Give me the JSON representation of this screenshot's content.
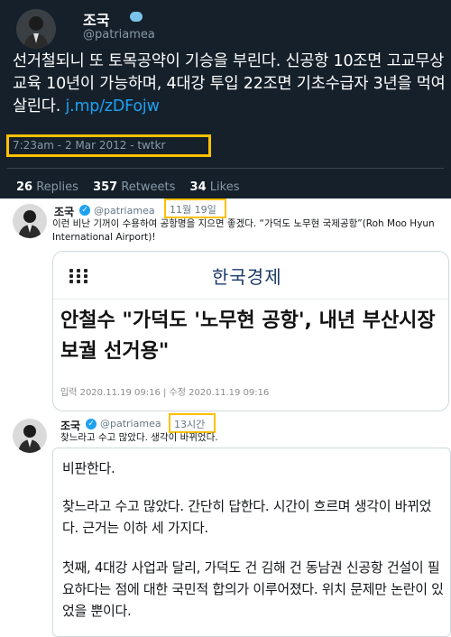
{
  "tweet_dark": {
    "name": "조국",
    "handle": "@patriamea",
    "text": "선거철되니 또 토목공약이 기승을 부린다. 신공항 10조면 고교무상교육 10년이 가능하며, 4대강 투입 22조면 기초수급자 3년을 먹여살린다. ",
    "link": "j.mp/zDFojw",
    "timestamp": "7:23am - 2 Mar 2012 - twtkr",
    "stats": {
      "replies_count": "26",
      "replies_label": "Replies",
      "retweets_count": "357",
      "retweets_label": "Retweets",
      "likes_count": "34",
      "likes_label": "Likes"
    }
  },
  "tweet_card": {
    "name": "조국",
    "handle": "@patriamea",
    "date": "11월 19일",
    "text": "이런 비난 기꺼이 수용하여 공항명을 지으면 좋겠다. “가덕도 노무현 국제공항”(Roh Moo Hyun International Airport)!",
    "card": {
      "source": "한국경제",
      "headline": "안철수 \"가덕도 '노무현 공항', 내년 부산시장 보궐 선거용\"",
      "meta": "입력 2020.11.19 09:16  |  수정 2020.11.19 09:16"
    }
  },
  "tweet_essay": {
    "name": "조국",
    "handle": "@patriamea",
    "time": "13시간",
    "text": "찾느라고 수고 많았다. 생각이 바뀌었다.",
    "essay": [
      "비판한다.",
      "찾느라고 수고 많았다. 간단히 답한다. 시간이 흐르며 생각이 바뀌었다. 근거는 이하 세 가지다.",
      "첫째, 4대강 사업과 달리, 가덕도 건 김해 건 동남권 신공항 건설이 필요하다는 점에 대한 국민적 합의가 이루어졌다. 위치 문제만 논란이 있었을 뿐이다."
    ]
  }
}
